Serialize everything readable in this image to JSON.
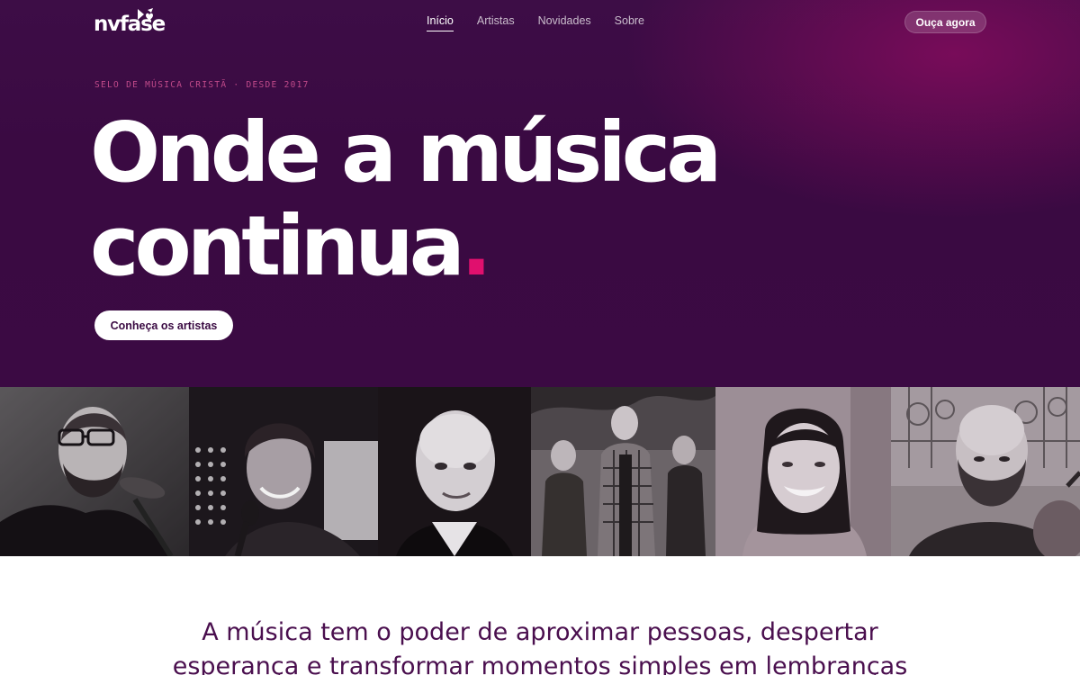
{
  "brand": {
    "logo_text": "nvfase"
  },
  "nav": {
    "items": [
      {
        "label": "Início",
        "active": true
      },
      {
        "label": "Artistas",
        "active": false
      },
      {
        "label": "Novidades",
        "active": false
      },
      {
        "label": "Sobre",
        "active": false
      }
    ],
    "listen_button": "Ouça agora"
  },
  "hero": {
    "eyebrow": "SELO DE MÚSICA CRISTÃ · DESDE 2017",
    "headline_line1": "Onde a música",
    "headline_line2": "continua",
    "headline_dot": ".",
    "cta_label": "Conheça os artistas"
  },
  "artists_strip": {
    "photos": [
      "artist-photo-1",
      "artist-photo-2",
      "artist-photo-3",
      "artist-photo-4",
      "artist-photo-5",
      "artist-photo-6"
    ]
  },
  "about": {
    "tagline": "A música tem o poder de aproximar pessoas, despertar esperança e transformar momentos simples em lembranças"
  },
  "colors": {
    "hero_bg": "#3a0a42",
    "accent": "#e0106e",
    "eyebrow": "#c14a8a",
    "tagline": "#4a0f4e"
  }
}
